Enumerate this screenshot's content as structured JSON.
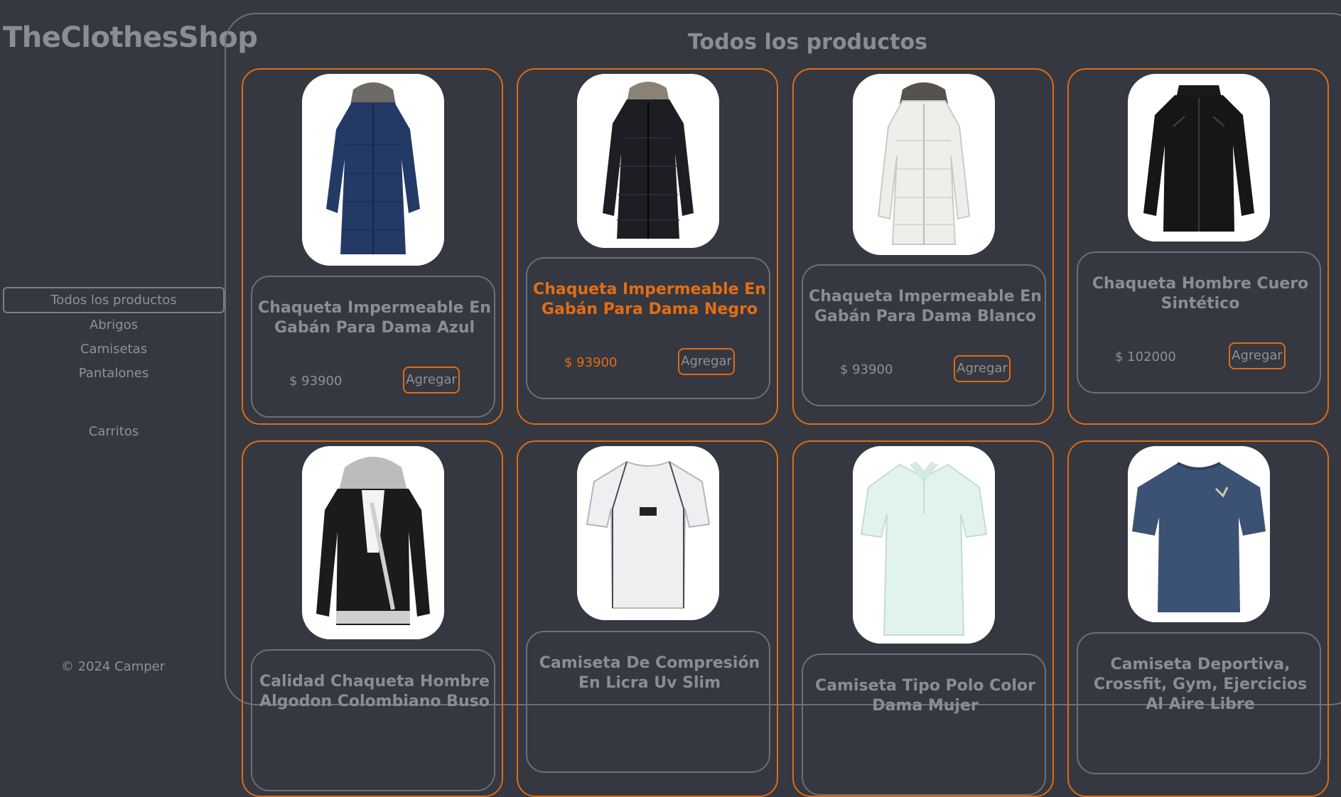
{
  "brand": "TheClothesShop",
  "nav": {
    "all": "Todos los productos",
    "coats": "Abrigos",
    "shirts": "Camisetas",
    "pants": "Pantalones",
    "carts": "Carritos"
  },
  "footer": "© 2024 Camper",
  "main": {
    "title": "Todos los productos"
  },
  "add_label": "Agregar",
  "colors": {
    "accent": "#e06a12",
    "background": "#353840",
    "border": "#6b6f76"
  },
  "products": [
    {
      "name": "Chaqueta Impermeable En Gabán Para Dama Azul",
      "price": "$ 93900",
      "image": "navy-parka-icon"
    },
    {
      "name": "Chaqueta Impermeable En Gabán Para Dama Negro",
      "price": "$ 93900",
      "image": "black-parka-icon"
    },
    {
      "name": "Chaqueta Impermeable En Gabán Para Dama Blanco",
      "price": "$ 93900",
      "image": "white-parka-icon"
    },
    {
      "name": "Chaqueta Hombre Cuero Sintético",
      "price": "$ 102000",
      "image": "leather-jacket-icon"
    },
    {
      "name": "Calidad Chaqueta Hombre Algodon Colombiano Buso",
      "price": "",
      "image": "hooded-jacket-icon"
    },
    {
      "name": "Camiseta De Compresión En Licra Uv Slim",
      "price": "",
      "image": "compression-shirt-icon"
    },
    {
      "name": "Camiseta Tipo Polo Color Dama Mujer",
      "price": "",
      "image": "polo-shirt-icon"
    },
    {
      "name": "Camiseta Deportiva, Crossfit, Gym, Ejercicios Al Aire Libre",
      "price": "",
      "image": "sport-tshirt-icon"
    }
  ]
}
